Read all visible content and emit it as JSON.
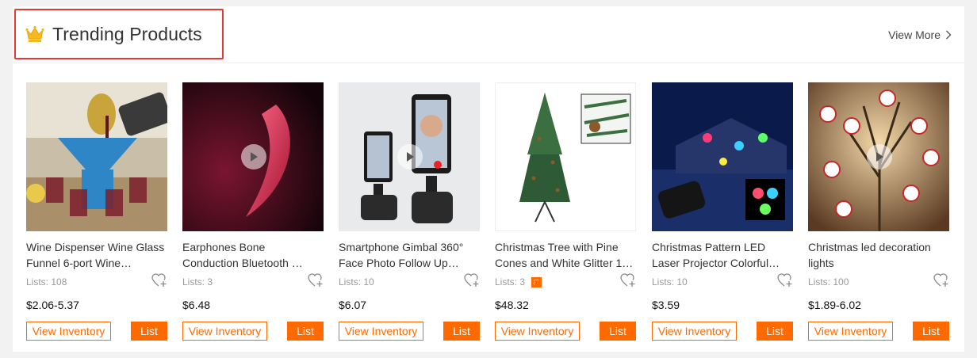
{
  "section": {
    "title": "Trending Products",
    "view_more": "View More"
  },
  "theme": {
    "accent": "#ff6a00",
    "highlight_border": "#e53935"
  },
  "products": [
    {
      "name": "Wine Dispenser Wine Glass Funnel 6-port Wine…",
      "lists": "Lists: 108",
      "price": "$2.06-5.37",
      "inventory_label": "View Inventory",
      "list_label": "List",
      "has_video": false,
      "has_badge": false
    },
    {
      "name": "Earphones Bone Conduction Bluetooth Earphones…",
      "lists": "Lists: 3",
      "price": "$6.48",
      "inventory_label": "View Inventory",
      "list_label": "List",
      "has_video": true,
      "has_badge": false
    },
    {
      "name": "Smartphone Gimbal 360° Face Photo Follow Up…",
      "lists": "Lists: 10",
      "price": "$6.07",
      "inventory_label": "View Inventory",
      "list_label": "List",
      "has_video": true,
      "has_badge": false
    },
    {
      "name": "Christmas Tree with Pine Cones and White Glitter 1…",
      "lists": "Lists: 3",
      "price": "$48.32",
      "inventory_label": "View Inventory",
      "list_label": "List",
      "has_video": false,
      "has_badge": true
    },
    {
      "name": "Christmas Pattern LED Laser Projector Colorful…",
      "lists": "Lists: 10",
      "price": "$3.59",
      "inventory_label": "View Inventory",
      "list_label": "List",
      "has_video": false,
      "has_badge": false
    },
    {
      "name": "Christmas led decoration lights",
      "lists": "Lists: 100",
      "price": "$1.89-6.02",
      "inventory_label": "View Inventory",
      "list_label": "List",
      "has_video": true,
      "has_badge": false
    }
  ]
}
